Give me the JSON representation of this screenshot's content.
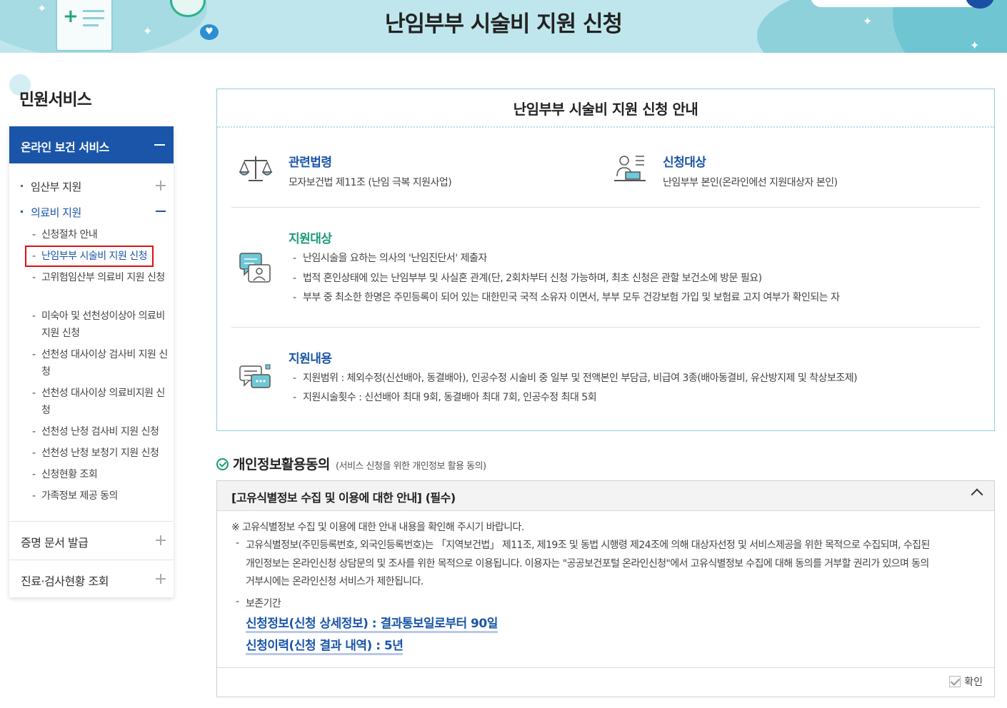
{
  "banner": {
    "title": "난임부부 시술비 지원 신청"
  },
  "sidebar": {
    "heading": "민원서비스",
    "section_open": "온라인 보건 서비스",
    "groups": [
      {
        "label": "임산부 지원",
        "state": "collapsed"
      },
      {
        "label": "의료비 지원",
        "state": "expanded"
      }
    ],
    "subitems": [
      "신청절차 안내",
      "난임부부 시술비 지원 신청",
      "고위험임산부 의료비 지원 신청",
      "미숙아 및 선천성이상아 의료비 지원 신청",
      "선천성 대사이상 검사비 지원 신청",
      "선천성 대사이상 의료비지원 신청",
      "선천성 난청 검사비 지원 신청",
      "선천성 난청 보청기 지원 신청",
      "신청현황 조회",
      "가족정보 제공 동의"
    ],
    "bottom": [
      "증명 문서 발급",
      "진료·검사현황 조회"
    ]
  },
  "info": {
    "title": "난임부부 시술비 지원 신청 안내",
    "law": {
      "heading": "관련법령",
      "text": "모자보건법 제11조 (난임 극복 지원사업)",
      "icon": "scales-icon"
    },
    "applicant": {
      "heading": "신청대상",
      "text": "난임부부 본인(온라인에선 지원대상자 본인)",
      "icon": "person-desk-icon"
    },
    "eligibility": {
      "heading": "지원대상",
      "icon": "chat-person-icon",
      "items": [
        "난임시술을 요하는 의사의 '난임진단서' 제출자",
        "법적 혼인상태에 있는 난임부부 및 사실혼 관계(단, 2회차부터 신청 가능하며, 최초 신청은 관할 보건소에 방문 필요)",
        "부부 중 최소한 한명은 주민등록이 되어 있는 대한민국 국적 소유자 이면서, 부부 모두 건강보험 가입 및 보험료 고지 여부가 확인되는 자"
      ]
    },
    "content": {
      "heading": "지원내용",
      "icon": "speech-bubbles-icon",
      "items": [
        "지원범위 : 체외수정(신선배아, 동결배아), 인공수정 시술비 중 일부 및 전액본인 부담금, 비급여 3종(배아동결비, 유산방지제 및 착상보조제)",
        "지원시술횟수 :  신선배아 최대 9회, 동결배아 최대 7회, 인공수정 최대 5회"
      ]
    }
  },
  "consent": {
    "heading": "개인정보활용동의",
    "subheading": "(서비스 신청을 위한 개인정보 활용 동의)",
    "panel_title": "[고유식별정보 수집 및 이용에 대한 안내] (필수)",
    "notice": "※ 고유식별정보 수집 및 이용에 대한 안내 내용을 확인해 주시기 바랍니다.",
    "body_lines": [
      "고유식별정보(주민등록번호, 외국인등록번호)는 「지역보건법」 제11조, 제19조 및 동법 시행령 제24조에 의해 대상자선정 및 서비스제공을 위한 목적으로 수집되며, 수집된",
      "개인정보는 온라인신청 상담문의 및 조사를 위한 목적으로 이용됩니다. 이용자는 \"공공보건포털 온라인신청\"에서 고유식별정보 수집에 대해 동의를 거부할 권리가 있으며 동의",
      "거부시에는 온라인신청 서비스가 제한됩니다."
    ],
    "retention_label": "보존기간",
    "retention_items": [
      "신청정보(신청 상세정보) : 결과통보일로부터 90일",
      "신청이력(신청 결과 내역) : 5년"
    ],
    "confirm_label": "확인",
    "confirm_checked": true
  },
  "colors": {
    "primary": "#1a55a9",
    "green": "#1a9a7a",
    "banner_bg": "#bfe6ec",
    "highlight_box": "#e01010"
  }
}
